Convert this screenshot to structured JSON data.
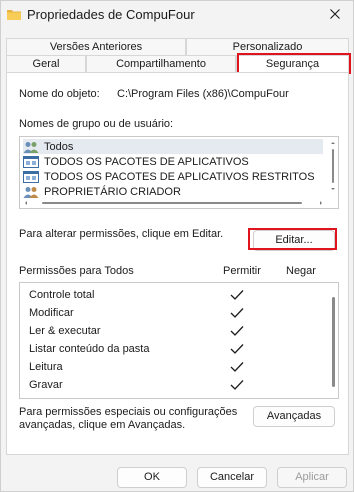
{
  "window": {
    "title": "Propriedades de CompuFour"
  },
  "tabs_back": [
    "Versões Anteriores",
    "Personalizado"
  ],
  "tabs_front": [
    "Geral",
    "Compartilhamento",
    "Segurança"
  ],
  "object": {
    "label": "Nome do objeto:",
    "value": "C:\\Program Files (x86)\\CompuFour"
  },
  "groups": {
    "label": "Nomes de grupo ou de usuário:",
    "items": [
      {
        "name": "Todos",
        "icon": "users-icon"
      },
      {
        "name": "TODOS OS PACOTES DE APLICATIVOS",
        "icon": "app-package-icon"
      },
      {
        "name": "TODOS OS PACOTES DE APLICATIVOS RESTRITOS",
        "icon": "app-package-icon"
      },
      {
        "name": "PROPRIETÁRIO CRIADOR",
        "icon": "users-icon"
      }
    ]
  },
  "edit": {
    "hint": "Para alterar permissões, clique em Editar.",
    "button": "Editar..."
  },
  "permissions": {
    "title": "Permissões para Todos",
    "col_allow": "Permitir",
    "col_deny": "Negar",
    "rows": [
      {
        "name": "Controle total",
        "allow": true,
        "deny": false
      },
      {
        "name": "Modificar",
        "allow": true,
        "deny": false
      },
      {
        "name": "Ler & executar",
        "allow": true,
        "deny": false
      },
      {
        "name": "Listar conteúdo da pasta",
        "allow": true,
        "deny": false
      },
      {
        "name": "Leitura",
        "allow": true,
        "deny": false
      },
      {
        "name": "Gravar",
        "allow": true,
        "deny": false
      }
    ]
  },
  "advanced": {
    "hint_line1": "Para permissões especiais ou configurações",
    "hint_line2": "avançadas, clique em Avançadas.",
    "button": "Avançadas"
  },
  "footer": {
    "ok": "OK",
    "cancel": "Cancelar",
    "apply": "Aplicar"
  },
  "colors": {
    "highlight": "#e0141e",
    "check": "#1b1b1b"
  }
}
